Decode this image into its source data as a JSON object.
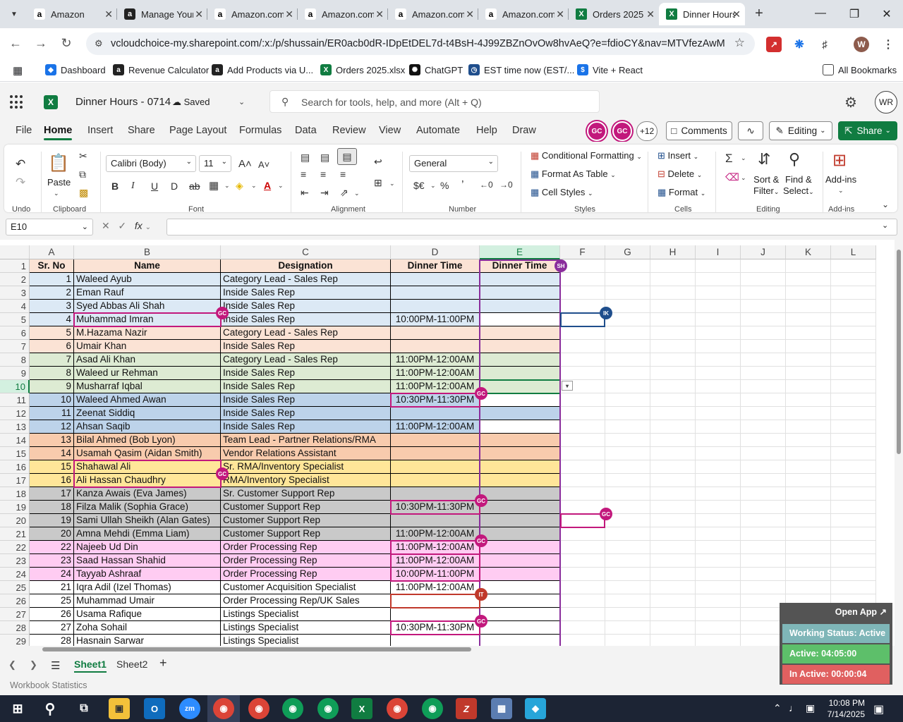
{
  "browser": {
    "tabs": [
      {
        "label": "Amazon",
        "icon": "amazon-favicon",
        "active": false
      },
      {
        "label": "Manage Your",
        "icon": "amazon-seller-favicon",
        "active": false
      },
      {
        "label": "Amazon.com",
        "icon": "amazon-favicon",
        "active": false
      },
      {
        "label": "Amazon.com",
        "icon": "amazon-favicon",
        "active": false
      },
      {
        "label": "Amazon.com",
        "icon": "amazon-favicon",
        "active": false
      },
      {
        "label": "Amazon.com",
        "icon": "amazon-favicon",
        "active": false
      },
      {
        "label": "Orders 2025",
        "icon": "excel-favicon",
        "active": false
      },
      {
        "label": "Dinner Hours",
        "icon": "excel-favicon",
        "active": true
      }
    ],
    "url": "vcloudchoice-my.sharepoint.com/:x:/p/shussain/ER0acb0dR-IDpEtDEL7d-t4BsH-4J99ZBZnOvOw8hvAeQ?e=fdioCY&nav=MTVfezAwMDA...",
    "profile_initial": "W",
    "bookmarks": [
      {
        "label": "Dashboard",
        "icon": "diamond-icon"
      },
      {
        "label": "Revenue Calculator",
        "icon": "amazon-icon"
      },
      {
        "label": "Add Products via U...",
        "icon": "amazon-icon"
      },
      {
        "label": "Orders 2025.xlsx",
        "icon": "excel-icon"
      },
      {
        "label": "ChatGPT",
        "icon": "chatgpt-icon"
      },
      {
        "label": "EST time now (EST/...",
        "icon": "clock-icon"
      },
      {
        "label": "Vite + React",
        "icon": "vite-icon"
      }
    ],
    "all_bookmarks": "All Bookmarks"
  },
  "excel": {
    "doc_title": "Dinner Hours - 0714",
    "save_status": "Saved",
    "search_placeholder": "Search for tools, help, and more (Alt + Q)",
    "account_initials": "WR",
    "menu": [
      "File",
      "Home",
      "Insert",
      "Share",
      "Page Layout",
      "Formulas",
      "Data",
      "Review",
      "View",
      "Automate",
      "Help",
      "Draw"
    ],
    "active_menu": "Home",
    "presence": [
      "GC",
      "GC"
    ],
    "presence_more": "+12",
    "comments_label": "Comments",
    "editing_label": "Editing",
    "share_label": "Share",
    "ribbon": {
      "groups": [
        "Undo",
        "Clipboard",
        "Font",
        "Alignment",
        "Number",
        "Styles",
        "Cells",
        "Editing",
        "Add-ins"
      ],
      "paste": "Paste",
      "font_name": "Calibri (Body)",
      "font_size": "11",
      "number_format": "General",
      "conditional_formatting": "Conditional Formatting",
      "format_as_table": "Format As Table",
      "cell_styles": "Cell Styles",
      "insert": "Insert",
      "delete": "Delete",
      "format": "Format",
      "sort_filter_1": "Sort &",
      "sort_filter_2": "Filter",
      "find_select_1": "Find &",
      "find_select_2": "Select",
      "add_ins": "Add-ins"
    },
    "name_box": "E10",
    "columns": [
      "A",
      "B",
      "C",
      "D",
      "E",
      "F",
      "G",
      "H",
      "I",
      "J",
      "K",
      "L"
    ],
    "selected_column": "E",
    "selected_row": "10",
    "header": {
      "sr": "Sr. No",
      "name": "Name",
      "designation": "Designation",
      "dinner1": "Dinner Time",
      "dinner2": "Dinner Time"
    },
    "rows": [
      {
        "r": "2",
        "sr": "1",
        "name": "Waleed Ayub",
        "designation": "Category Lead - Sales Rep",
        "dinner": "",
        "color": "#dce9f5"
      },
      {
        "r": "3",
        "sr": "2",
        "name": "Eman Rauf",
        "designation": "Inside Sales Rep",
        "dinner": "",
        "color": "#dce9f5"
      },
      {
        "r": "4",
        "sr": "3",
        "name": "Syed Abbas Ali Shah",
        "designation": "Inside Sales Rep",
        "dinner": "",
        "color": "#dce9f5"
      },
      {
        "r": "5",
        "sr": "4",
        "name": "Muhammad Imran",
        "designation": "Inside Sales Rep",
        "dinner": "10:00PM-11:00PM",
        "color": "#dce9f5"
      },
      {
        "r": "6",
        "sr": "5",
        "name": "M.Hazama Nazir",
        "designation": "Category Lead - Sales Rep",
        "dinner": "",
        "color": "#fbe3d5"
      },
      {
        "r": "7",
        "sr": "6",
        "name": "Umair Khan",
        "designation": "Inside Sales Rep",
        "dinner": "",
        "color": "#fbe3d5"
      },
      {
        "r": "8",
        "sr": "7",
        "name": "Asad Ali Khan",
        "designation": "Category Lead - Sales Rep",
        "dinner": "11:00PM-12:00AM",
        "color": "#ddebd3"
      },
      {
        "r": "9",
        "sr": "8",
        "name": "Waleed ur Rehman",
        "designation": "Inside Sales Rep",
        "dinner": "11:00PM-12:00AM",
        "color": "#ddebd3"
      },
      {
        "r": "10",
        "sr": "9",
        "name": "Musharraf Iqbal",
        "designation": "Inside Sales Rep",
        "dinner": "11:00PM-12:00AM",
        "color": "#ddebd3"
      },
      {
        "r": "11",
        "sr": "10",
        "name": "Waleed Ahmed Awan",
        "designation": "Inside Sales Rep",
        "dinner": "10:30PM-11:30PM",
        "color": "#bdd3ea"
      },
      {
        "r": "12",
        "sr": "11",
        "name": "Zeenat Siddiq",
        "designation": "Inside Sales Rep",
        "dinner": "",
        "color": "#bdd3ea"
      },
      {
        "r": "13",
        "sr": "12",
        "name": "Ahsan Saqib",
        "designation": "Inside Sales Rep",
        "dinner": "11:00PM-12:00AM",
        "color": "#bdd3ea"
      },
      {
        "r": "14",
        "sr": "13",
        "name": "Bilal Ahmed (Bob Lyon)",
        "designation": "Team Lead - Partner Relations/RMA",
        "dinner": "",
        "color": "#f8cbad"
      },
      {
        "r": "15",
        "sr": "14",
        "name": "Usamah Qasim (Aidan Smith)",
        "designation": "Vendor Relations Assistant",
        "dinner": "",
        "color": "#f8cbad"
      },
      {
        "r": "16",
        "sr": "15",
        "name": "Shahawal Ali",
        "designation": "Sr. RMA/Inventory Specialist",
        "dinner": "",
        "color": "#ffe699"
      },
      {
        "r": "17",
        "sr": "16",
        "name": "Ali Hassan Chaudhry",
        "designation": "RMA/Inventory Specialist",
        "dinner": "",
        "color": "#ffe699"
      },
      {
        "r": "18",
        "sr": "17",
        "name": "Kanza Awais (Eva James)",
        "designation": "Sr. Customer Support Rep",
        "dinner": "",
        "color": "#c9c9c9"
      },
      {
        "r": "19",
        "sr": "18",
        "name": "Filza Malik (Sophia Grace)",
        "designation": "Customer Support Rep",
        "dinner": "10:30PM-11:30PM",
        "color": "#c9c9c9"
      },
      {
        "r": "20",
        "sr": "19",
        "name": "Sami Ullah Sheikh (Alan Gates)",
        "designation": "Customer Support Rep",
        "dinner": "",
        "color": "#c9c9c9"
      },
      {
        "r": "21",
        "sr": "20",
        "name": "Amna Mehdi (Emma Liam)",
        "designation": "Customer Support Rep",
        "dinner": "11:00PM-12:00AM",
        "color": "#c9c9c9"
      },
      {
        "r": "22",
        "sr": "22",
        "name": "Najeeb Ud Din",
        "designation": "Order Processing Rep",
        "dinner": "11:00PM-12:00AM",
        "color": "#ffccf2"
      },
      {
        "r": "23",
        "sr": "23",
        "name": "Saad Hassan Shahid",
        "designation": "Order Processing Rep",
        "dinner": "11:00PM-12:00AM",
        "color": "#ffccf2"
      },
      {
        "r": "24",
        "sr": "24",
        "name": "Tayyab Ashraaf",
        "designation": "Order Processing Rep",
        "dinner": "10:00PM-11:00PM",
        "color": "#ffccf2"
      },
      {
        "r": "25",
        "sr": "21",
        "name": "Iqra Adil (Izel Thomas)",
        "designation": "Customer Acquisition Specialist",
        "dinner": "11:00PM-12:00AM",
        "color": "#ffffff"
      },
      {
        "r": "26",
        "sr": "25",
        "name": "Muhammad Umair",
        "designation": "Order Processing Rep/UK Sales",
        "dinner": "",
        "color": "#ffffff"
      },
      {
        "r": "27",
        "sr": "26",
        "name": "Usama Rafique",
        "designation": "Listings Specialist",
        "dinner": "",
        "color": "#ffffff"
      },
      {
        "r": "28",
        "sr": "27",
        "name": "Zoha Sohail",
        "designation": "Listings Specialist",
        "dinner": "10:30PM-11:30PM",
        "color": "#ffffff"
      },
      {
        "r": "29",
        "sr": "28",
        "name": "Hasnain Sarwar",
        "designation": "Listings Specialist",
        "dinner": "",
        "color": "#ffffff"
      }
    ],
    "cursor_tags": [
      "SH",
      "IK",
      "GC",
      "IT"
    ],
    "sheets": [
      "Sheet1",
      "Sheet2"
    ],
    "active_sheet": "Sheet1",
    "workbook_statistics": "Workbook Statistics"
  },
  "widget": {
    "open_app": "Open App ↗",
    "working_status": "Working Status: Active",
    "active": "Active: 04:05:00",
    "inactive": "In Active: 00:00:04"
  },
  "taskbar": {
    "time": "10:08 PM",
    "date": "7/14/2025"
  },
  "colors": {
    "excel_green": "#107c41",
    "collab_magenta": "#c2187c",
    "collab_blue": "#1f4e8c",
    "collab_red": "#c0392b"
  }
}
